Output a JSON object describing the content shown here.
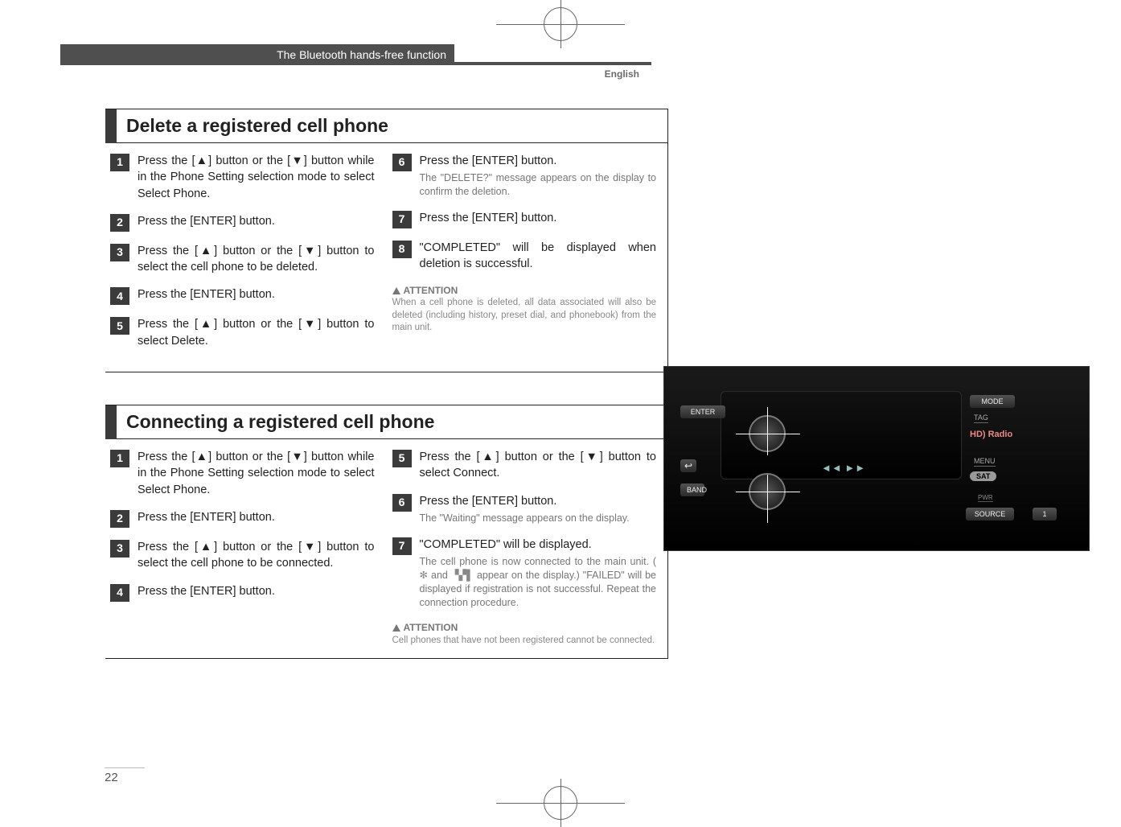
{
  "header": {
    "breadcrumb": "The Bluetooth hands-free function",
    "language": "English"
  },
  "section1": {
    "title": "Delete a registered cell phone",
    "left": [
      {
        "n": "1",
        "main": "Press the [▲] button or the [▼] button while in the Phone Setting selection mode to select Select Phone."
      },
      {
        "n": "2",
        "main": "Press the [ENTER] button."
      },
      {
        "n": "3",
        "main": "Press the [▲] button or the [▼] button to select the cell phone to be deleted."
      },
      {
        "n": "4",
        "main": "Press the [ENTER] button."
      },
      {
        "n": "5",
        "main": "Press the [▲] button or the [▼] button to select Delete."
      }
    ],
    "right": [
      {
        "n": "6",
        "main": "Press the [ENTER] button.",
        "sub": "The \"DELETE?\" message appears on the display to confirm the deletion."
      },
      {
        "n": "7",
        "main": "Press the [ENTER] button."
      },
      {
        "n": "8",
        "main": "\"COMPLETED\" will be displayed when deletion is successful."
      }
    ],
    "attention": {
      "label": "ATTENTION",
      "body": "When a cell phone is deleted, all data associated will also be deleted (including history, preset dial, and phonebook) from the main unit."
    }
  },
  "section2": {
    "title": "Connecting a registered cell phone",
    "left": [
      {
        "n": "1",
        "main": "Press the [▲] button or the [▼] button while in the Phone Setting selection mode to select Select Phone."
      },
      {
        "n": "2",
        "main": "Press the [ENTER] button."
      },
      {
        "n": "3",
        "main": "Press the [▲] button or the [▼] button to select the cell phone to be connected."
      },
      {
        "n": "4",
        "main": "Press the [ENTER] button."
      }
    ],
    "right": [
      {
        "n": "5",
        "main": "Press the [▲] button or the [▼] button to select Connect."
      },
      {
        "n": "6",
        "main": "Press the [ENTER] button.",
        "sub": "The \"Waiting\" message appears on the display."
      },
      {
        "n": "7",
        "main": "\"COMPLETED\" will be displayed.",
        "sub": "The cell phone is now connected to the main unit. (   and   appear on the display.) \"FAILED\" will be displayed if registration is not successful. Repeat the connection procedure."
      }
    ],
    "attention": {
      "label": "ATTENTION",
      "body": "Cell phones that have not been registered cannot be connected."
    }
  },
  "device": {
    "enter": "ENTER",
    "mode": "MODE",
    "tag": "TAG",
    "hdradio": "HD) Radio",
    "menu": "MENU",
    "band": "BAND",
    "sat": "SAT",
    "pwr": "PWR",
    "source": "SOURCE",
    "preset1": "1",
    "back_icon": "↩",
    "arrows": "◄◄    ►►",
    "knob1": "▲",
    "knob2": "▼"
  },
  "page_number": "22"
}
